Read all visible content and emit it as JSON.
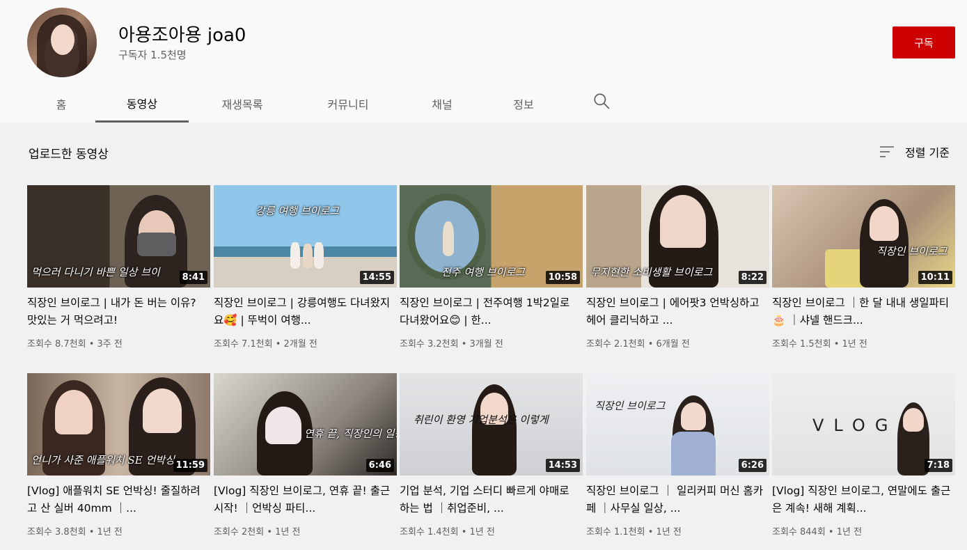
{
  "channel": {
    "name": "아용조아용 joa0",
    "subscribers": "구독자 1.5천명",
    "subscribe_label": "구독"
  },
  "tabs": [
    {
      "label": "홈"
    },
    {
      "label": "동영상"
    },
    {
      "label": "재생목록"
    },
    {
      "label": "커뮤니티"
    },
    {
      "label": "채널"
    },
    {
      "label": "정보"
    }
  ],
  "section": {
    "title": "업로드한 동영상",
    "sort_label": "정렬 기준"
  },
  "colors": {
    "subscribe": "#cc0000",
    "page_bg": "#f1f1f1",
    "header_bg": "#f9f9f9"
  },
  "videos": [
    {
      "caption": "먹으러 다니기 바쁜 일상 브이",
      "duration": "8:41",
      "title": "직장인 브이로그 | 내가 돈 버는 이유? 맛있는 거 먹으려고!",
      "meta": "조회수 8.7천회 • 3주 전"
    },
    {
      "caption": "강릉 여행 브이로그",
      "duration": "14:55",
      "title": "직장인 브이로그 | 강릉여행도 다녀왔지요🥰 | 뚜벅이 여행...",
      "meta": "조회수 7.1천회 • 2개월 전"
    },
    {
      "caption": "전주 여행 브이로그",
      "duration": "10:58",
      "title": "직장인 브이로그 | 전주여행 1박2일로 다녀왔어요😊 | 한...",
      "meta": "조회수 3.2천회 • 3개월 전"
    },
    {
      "caption": "무지현한 소비생활 브이로그",
      "duration": "8:22",
      "title": "직장인 브이로그 | 에어팟3 언박싱하고 헤어 클리닉하고 ...",
      "meta": "조회수 2.1천회 • 6개월 전"
    },
    {
      "caption": "직장인 브이로그",
      "duration": "10:11",
      "title": "직장인 브이로그 ｜한 달 내내 생일파티🎂 ｜샤넬 핸드크...",
      "meta": "조회수 1.5천회 • 1년 전"
    },
    {
      "caption": "언니가 사준 애플워치 SE 언박싱",
      "duration": "11:59",
      "title": "[Vlog] 애플워치 SE 언박싱! 줄질하려고 산 실버 40mm ｜...",
      "meta": "조회수 3.8천회 • 1년 전"
    },
    {
      "caption": "연휴 끝, 직장인의 일상은 여전하다",
      "duration": "6:46",
      "title": "[Vlog] 직장인 브이로그, 연휴 끝! 출근 시작! ｜언박싱 파티...",
      "meta": "조회수 2천회 • 1년 전"
    },
    {
      "caption": "취린이 환영 기업분석은 이렇게",
      "duration": "14:53",
      "title": "기업 분석, 기업 스터디 빠르게 야매로 하는 법 ｜취업준비, ...",
      "meta": "조회수 1.4천회 • 1년 전"
    },
    {
      "caption": "직장인 브이로그",
      "duration": "6:26",
      "title": "직장인 브이로그 ｜ 일리커피 머신 홈카페 ｜사무실 일상, ...",
      "meta": "조회수 1.1천회 • 1년 전"
    },
    {
      "caption": "VLOG",
      "duration": "7:18",
      "title": "[Vlog] 직장인 브이로그, 연말에도 출근은 계속! 새해 계획...",
      "meta": "조회수 844회 • 1년 전"
    }
  ]
}
